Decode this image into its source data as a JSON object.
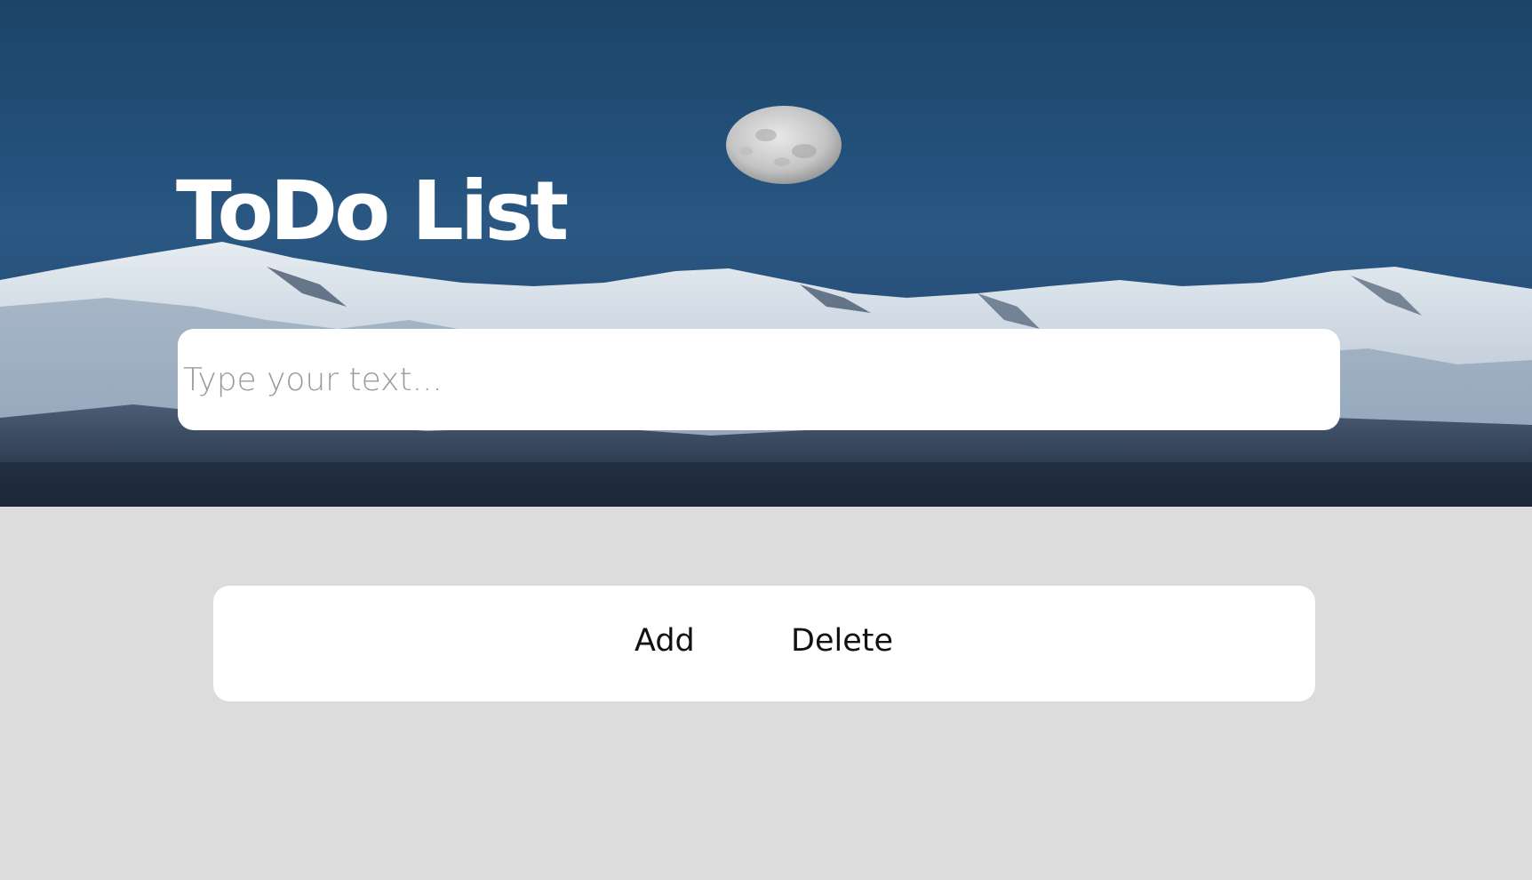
{
  "header": {
    "title": "ToDo List"
  },
  "task_input": {
    "placeholder": "Type your text...",
    "value": ""
  },
  "actions": {
    "add_label": "Add",
    "delete_label": "Delete"
  },
  "colors": {
    "page_background": "#dcdcdc",
    "sky": "#23507a",
    "card": "#ffffff",
    "title": "#ffffff",
    "button_text": "#111111"
  }
}
